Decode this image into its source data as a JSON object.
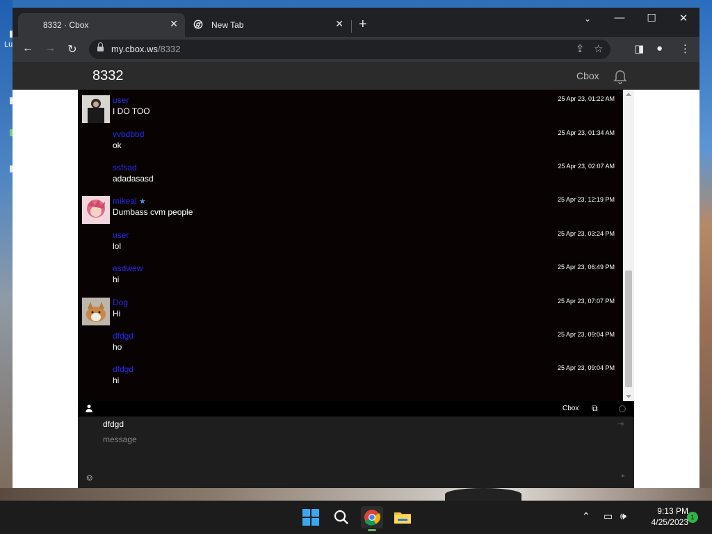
{
  "desktop": {
    "left_label": "Lu"
  },
  "browser": {
    "tabs": [
      {
        "title": "8332 · Cbox",
        "active": true
      },
      {
        "title": "New Tab",
        "active": false
      }
    ],
    "url": {
      "host": "my.cbox.ws",
      "path": "/8332"
    }
  },
  "cbox": {
    "title": "8332",
    "brand_link": "Cbox",
    "messages": [
      {
        "user": "user",
        "text": "I DO TOO",
        "time": "25 Apr 23, 01:22 AM",
        "avatar": "dark-figure",
        "verified": false
      },
      {
        "user": "vvbdbbd",
        "text": "ok",
        "time": "25 Apr 23, 01:34 AM",
        "avatar": "",
        "verified": false
      },
      {
        "user": "ssfsad",
        "text": "adadasasd",
        "time": "25 Apr 23, 02:07 AM",
        "avatar": "",
        "verified": false
      },
      {
        "user": "mikeal",
        "text": "Dumbass cvm people",
        "time": "25 Apr 23, 12:19 PM",
        "avatar": "pink-hair-anime",
        "verified": true
      },
      {
        "user": "user",
        "text": "lol",
        "time": "25 Apr 23, 03:24 PM",
        "avatar": "",
        "verified": false
      },
      {
        "user": "asdwew",
        "text": "hi",
        "time": "25 Apr 23, 06:49 PM",
        "avatar": "",
        "verified": false
      },
      {
        "user": "Dog",
        "text": "Hi",
        "time": "25 Apr 23, 07:07 PM",
        "avatar": "corgi",
        "verified": false
      },
      {
        "user": "dfdgd",
        "text": "ho",
        "time": "25 Apr 23, 09:04 PM",
        "avatar": "",
        "verified": false
      },
      {
        "user": "dfdgd",
        "text": "hi",
        "time": "25 Apr 23, 09:04 PM",
        "avatar": "",
        "verified": false
      }
    ],
    "bar": {
      "brand": "Cbox"
    },
    "input": {
      "name_value": "dfdgd",
      "message_placeholder": "message"
    },
    "colors": {
      "username": "#2a2af0",
      "message_bg": "#080202",
      "header_bg": "#2b2b2b"
    }
  },
  "taskbar": {
    "time": "9:13 PM",
    "date": "4/25/2023",
    "notification_count": "1"
  }
}
